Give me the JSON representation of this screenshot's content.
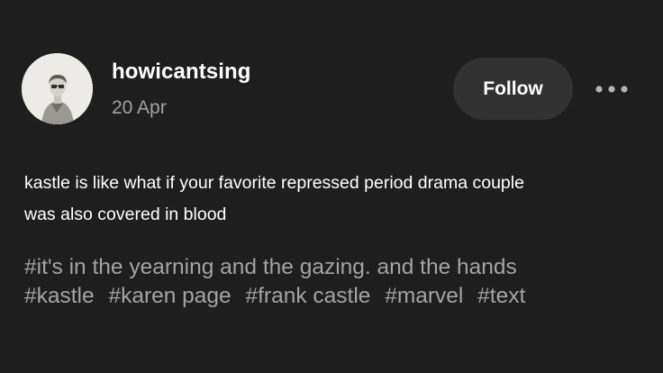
{
  "post": {
    "author": {
      "username": "howicantsing",
      "date": "20 Apr"
    },
    "follow_label": "Follow",
    "more_icon": "more-horizontal-icon",
    "text_lines": [
      "kastle is like what if your favorite repressed period drama couple",
      "was also covered in blood"
    ],
    "tags_line1": [
      "#it's in the yearning and the gazing. and the hands"
    ],
    "tags_line2": [
      "#kastle",
      "#karen page",
      "#frank castle",
      "#marvel",
      "#text"
    ]
  },
  "colors": {
    "background": "#1e1e1e",
    "button_bg": "#323232",
    "muted_text": "#a2a2a2"
  }
}
